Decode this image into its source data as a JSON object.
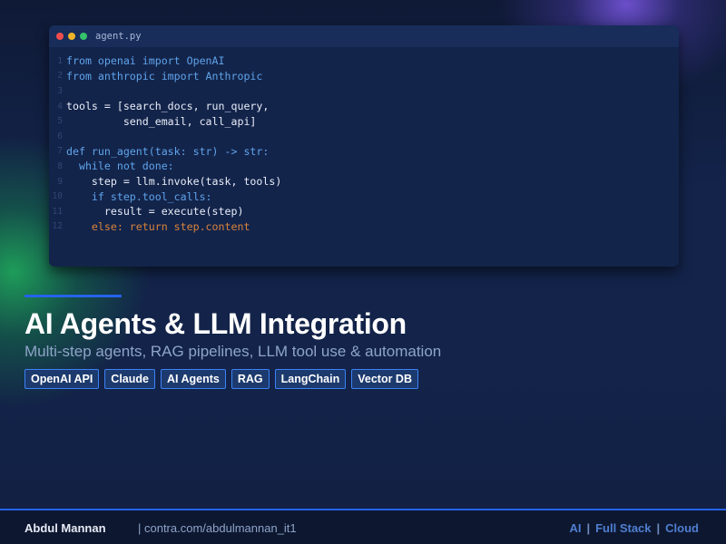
{
  "editor": {
    "filename": "agent.py",
    "lines": [
      {
        "n": "1",
        "text": "from openai import OpenAI",
        "color": "blue"
      },
      {
        "n": "2",
        "text": "from anthropic import Anthropic",
        "color": "blue"
      },
      {
        "n": "3",
        "text": "",
        "color": "blue"
      },
      {
        "n": "4",
        "text": "tools = [search_docs, run_query,",
        "color": "white"
      },
      {
        "n": "5",
        "text": "         send_email, call_api]",
        "color": "white"
      },
      {
        "n": "6",
        "text": "",
        "color": "blue"
      },
      {
        "n": "7",
        "text": "def run_agent(task: str) -> str:",
        "color": "blue"
      },
      {
        "n": "8",
        "text": "  while not done:",
        "color": "blue"
      },
      {
        "n": "9",
        "text": "    step = llm.invoke(task, tools)",
        "color": "white"
      },
      {
        "n": "10",
        "text": "    if step.tool_calls:",
        "color": "blue"
      },
      {
        "n": "11",
        "text": "      result = execute(step)",
        "color": "white"
      },
      {
        "n": "12",
        "text": "    else: return step.content",
        "color": "orange"
      }
    ]
  },
  "hero": {
    "title": "AI Agents & LLM Integration",
    "subtitle": "Multi-step agents, RAG pipelines, LLM tool use & automation"
  },
  "tags": [
    "OpenAI API",
    "Claude",
    "AI Agents",
    "RAG",
    "LangChain",
    "Vector DB"
  ],
  "footer": {
    "author": "Abdul Mannan",
    "link": "|  contra.com/abdulmannan_it1",
    "stack": [
      "AI",
      "Full Stack",
      "Cloud"
    ],
    "separator": "|"
  },
  "colors": {
    "accent": "#2563eb",
    "keyword_blue": "#5fa4ea",
    "code_white": "#e8edf7",
    "code_orange": "#d9843a",
    "background": "#12203f"
  },
  "icons": {
    "window_controls": [
      "close-dot-icon",
      "minimize-dot-icon",
      "maximize-dot-icon"
    ]
  }
}
